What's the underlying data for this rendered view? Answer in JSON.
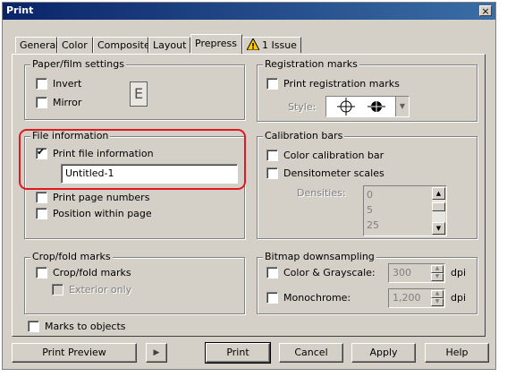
{
  "window": {
    "title": "Print",
    "close_glyph": "×"
  },
  "tabs": [
    "General",
    "Color",
    "Composite",
    "Layout",
    "Prepress",
    "1 Issue"
  ],
  "active_tab": "Prepress",
  "paper_film": {
    "label": "Paper/film settings",
    "invert": {
      "label": "Invert",
      "checked": false
    },
    "mirror": {
      "label": "Mirror",
      "checked": false
    },
    "preview_glyph": "E"
  },
  "file_info": {
    "label": "File information",
    "print_file_info": {
      "label": "Print file information",
      "checked": true
    },
    "filename": "Untitled-1",
    "page_numbers": {
      "label": "Print page numbers",
      "checked": false
    },
    "position_within_page": {
      "label": "Position within page",
      "checked": false
    }
  },
  "crop_fold": {
    "label": "Crop/fold marks",
    "crop_marks": {
      "label": "Crop/fold marks",
      "checked": false
    },
    "exterior_only": {
      "label": "Exterior only",
      "checked": false,
      "disabled": true
    }
  },
  "marks_to_objects": {
    "label": "Marks to objects",
    "checked": false
  },
  "registration": {
    "label": "Registration marks",
    "print_reg": {
      "label": "Print registration marks",
      "checked": false
    },
    "style_label": "Style:"
  },
  "calibration": {
    "label": "Calibration bars",
    "color_bar": {
      "label": "Color calibration bar",
      "checked": false
    },
    "densitometer": {
      "label": "Densitometer scales",
      "checked": false
    },
    "densities_label": "Densities:",
    "densities": [
      "0",
      "5",
      "25"
    ]
  },
  "bitmap": {
    "label": "Bitmap downsampling",
    "color_gray": {
      "label": "Color & Grayscale:",
      "checked": false,
      "value": "300",
      "unit": "dpi"
    },
    "monochrome": {
      "label": "Monochrome:",
      "checked": false,
      "value": "1,200",
      "unit": "dpi"
    }
  },
  "buttons": {
    "print_preview": "Print Preview",
    "preview_toggle_glyph": "▶",
    "print": "Print",
    "cancel": "Cancel",
    "apply": "Apply",
    "help": "Help"
  },
  "colors": {
    "title_bar": "#0a246a",
    "highlight_ring": "#e0191e",
    "warning": "#ffcc00"
  }
}
